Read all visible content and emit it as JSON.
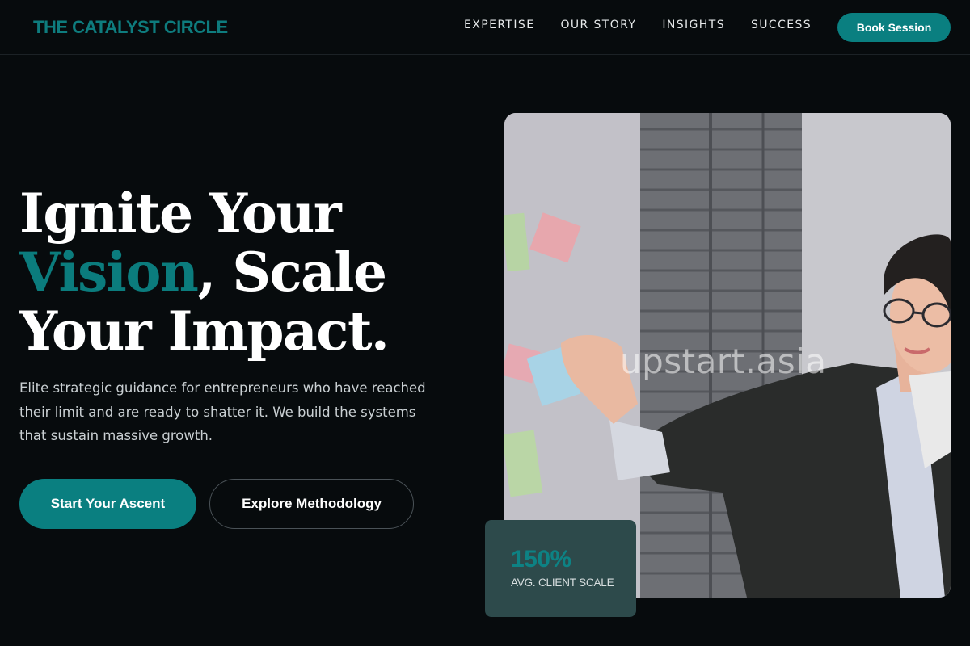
{
  "header": {
    "logo": "THE CATALYST CIRCLE",
    "nav": [
      "EXPERTISE",
      "OUR STORY",
      "INSIGHTS",
      "SUCCESS"
    ],
    "cta_label": "Book Session"
  },
  "hero": {
    "headline_line1": "Ignite Your",
    "headline_accent": "Vision",
    "headline_line2_rest": ", Scale",
    "headline_line3": "Your Impact.",
    "subtext": "Elite strategic guidance for entrepreneurs who have reached their limit and are ready to shatter it. We build the systems that sustain massive growth.",
    "primary_button": "Start Your Ascent",
    "secondary_button": "Explore Methodology"
  },
  "image": {
    "watermark": "upstart.asia"
  },
  "stat": {
    "value": "150%",
    "label": "AVG. CLIENT SCALE"
  },
  "colors": {
    "background": "#070b0d",
    "accent": "#0a7f80",
    "stat_card": "#2d4a4b"
  }
}
